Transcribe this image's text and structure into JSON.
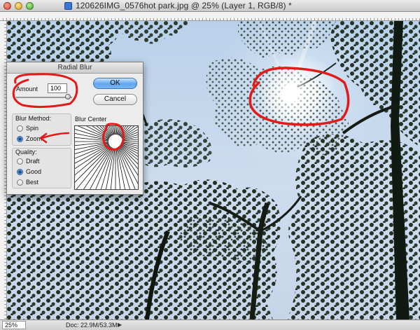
{
  "window": {
    "title": "120626IMG_0576hot park.jpg @ 25% (Layer 1, RGB/8) *"
  },
  "status": {
    "zoom": "25%",
    "doc_info": "Doc: 22.9M/53.3M"
  },
  "dialog": {
    "title": "Radial Blur",
    "amount_label": "Amount",
    "amount_value": "100",
    "amount_fraction": 1.0,
    "ok_label": "OK",
    "cancel_label": "Cancel",
    "blur_method": {
      "legend": "Blur Method:",
      "options": [
        {
          "label": "Spin",
          "selected": false
        },
        {
          "label": "Zoom",
          "selected": true
        }
      ]
    },
    "quality": {
      "legend": "Quality:",
      "options": [
        {
          "label": "Draft",
          "selected": false
        },
        {
          "label": "Good",
          "selected": true
        },
        {
          "label": "Best",
          "selected": false
        }
      ]
    },
    "blur_center_label": "Blur Center"
  },
  "colors": {
    "annotation_red": "#e11a1a",
    "accent_blue": "#4f8fd8"
  },
  "icons": {
    "close": "close-icon",
    "minimize": "minimize-icon",
    "maximize": "maximize-icon",
    "status_menu": "triangle-right-icon"
  }
}
